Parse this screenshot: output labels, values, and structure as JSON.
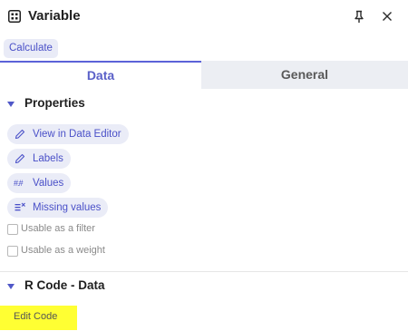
{
  "header": {
    "title": "Variable",
    "icon": "grid-icon",
    "actions": [
      "pin-icon",
      "close-icon"
    ]
  },
  "calculate_label": "Calculate",
  "tabs": [
    {
      "label": "Data",
      "active": true
    },
    {
      "label": "General",
      "active": false
    }
  ],
  "properties": {
    "title": "Properties",
    "actions": [
      {
        "label": "View in Data Editor",
        "icon": "pencil-icon"
      },
      {
        "label": "Labels",
        "icon": "pencil-icon"
      },
      {
        "label": "Values",
        "icon": "hash-icon",
        "glyph": "#.#"
      },
      {
        "label": "Missing values",
        "icon": "missing-values-icon"
      }
    ],
    "checkboxes": [
      {
        "label": "Usable as a filter",
        "checked": false
      },
      {
        "label": "Usable as a weight",
        "checked": false
      }
    ]
  },
  "r_code": {
    "title": "R Code - Data",
    "edit_label": "Edit Code",
    "highlight_color": "#ffff33"
  },
  "colors": {
    "accent": "#5b62d8",
    "pill_bg": "#eaecf7",
    "tab_inactive_bg": "#eceef3"
  }
}
